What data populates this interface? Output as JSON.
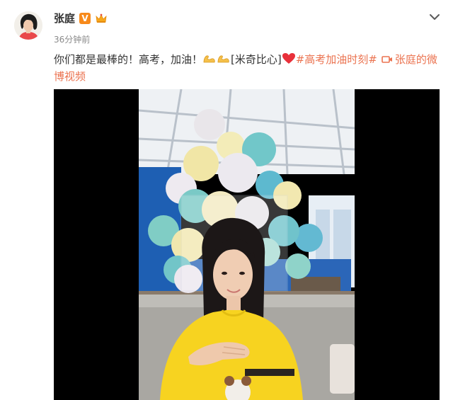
{
  "post": {
    "username": "张庭",
    "verified_badge": "V",
    "timestamp": "36分钟前",
    "text_before": "你们都是最棒的！高考，加油！",
    "emoji_text": "[米奇比心]",
    "hashtag": "#高考加油时刻#",
    "video_link_label": "张庭的微博视频"
  },
  "icons": {
    "avatar": "avatar",
    "verified": "verified-v-icon",
    "crown": "crown-icon",
    "more": "chevron-down-icon",
    "muscle": "muscle-emoji-icon",
    "heart": "heart-emoji-icon",
    "video": "video-camera-icon"
  },
  "colors": {
    "link": "#eb7350",
    "verified": "#f78a1b",
    "shirt": "#f7d320",
    "wall": "#1e5fb3"
  }
}
